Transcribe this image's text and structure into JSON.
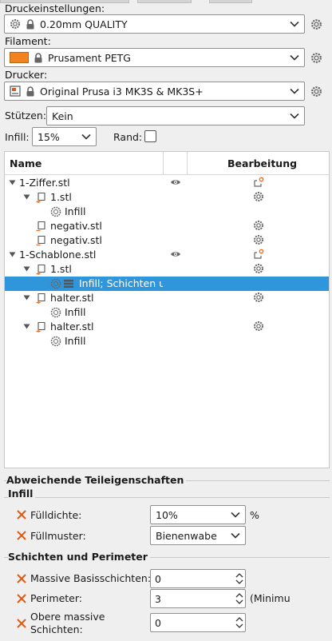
{
  "print_settings": {
    "label": "Druckeinstellungen:",
    "value": "0.20mm QUALITY"
  },
  "filament": {
    "label": "Filament:",
    "value": "Prusament PETG",
    "color": "#f58220"
  },
  "printer": {
    "label": "Drucker:",
    "value": "Original Prusa i3 MK3S & MK3S+"
  },
  "supports": {
    "label": "Stützen:",
    "value": "Kein"
  },
  "infill": {
    "label": "Infill:",
    "value": "15%"
  },
  "brim": {
    "label": "Rand:",
    "checked": false
  },
  "tree": {
    "col_name": "Name",
    "col_edit": "Bearbeitung",
    "rows": [
      {
        "label": "1-Ziffer.stl"
      },
      {
        "label": "1.stl"
      },
      {
        "label": "Infill"
      },
      {
        "label": "negativ.stl"
      },
      {
        "label": "negativ.stl"
      },
      {
        "label": "1-Schablone.stl"
      },
      {
        "label": "1.stl"
      },
      {
        "label": "Infill; Schichten ur",
        "selected": true
      },
      {
        "label": "halter.stl"
      },
      {
        "label": "Infill"
      },
      {
        "label": "halter.stl"
      },
      {
        "label": "Infill"
      }
    ]
  },
  "part_props": {
    "title": "Abweichende Teileigenschaften",
    "infill_group": "Infill",
    "fill_density": {
      "label": "Fülldichte:",
      "value": "10%",
      "unit": "%"
    },
    "fill_pattern": {
      "label": "Füllmuster:",
      "value": "Bienenwabe"
    },
    "layers_group": "Schichten und Perimeter",
    "bottom_layers": {
      "label": "Massive Basisschichten:",
      "value": "0"
    },
    "perimeters": {
      "label": "Perimeter:",
      "value": "3",
      "note": "(Minimu"
    },
    "top_layers": {
      "label_line1": "Obere massive",
      "label_line2": "Schichten:",
      "value": "0"
    }
  },
  "colors": {
    "selection": "#2f96db",
    "accent": "#ed6b21",
    "remove_x": "#e05a12"
  }
}
